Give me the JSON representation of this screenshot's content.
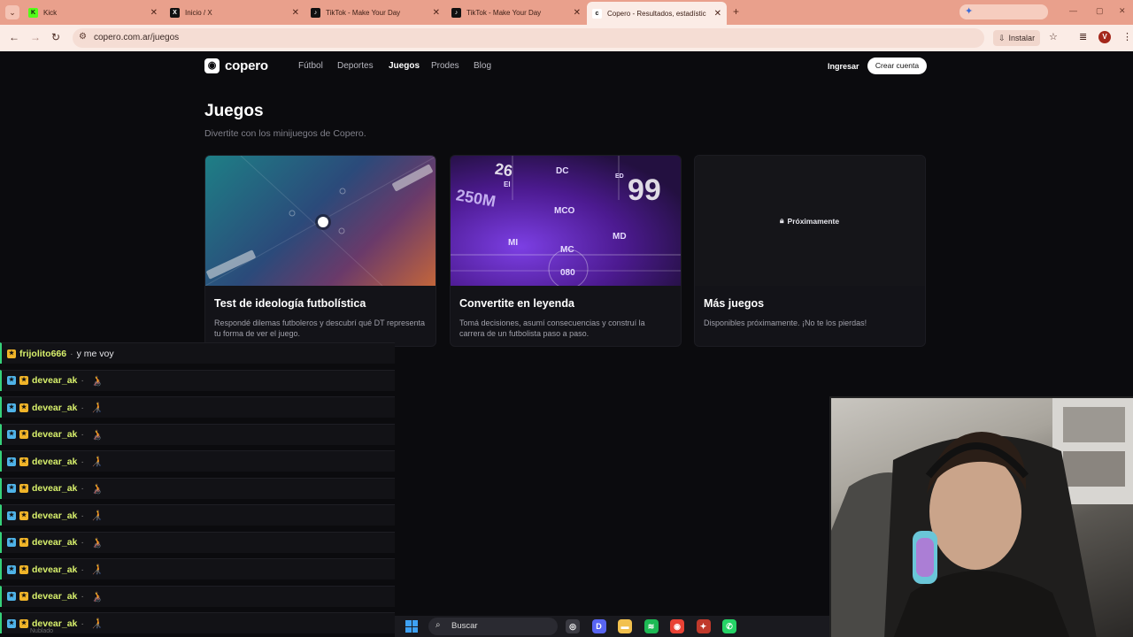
{
  "browser": {
    "tabs": [
      {
        "title": "Kick",
        "favicon": "kick-icon",
        "color": "#53fc18",
        "glyph": "K"
      },
      {
        "title": "Inicio / X",
        "favicon": "x-icon",
        "color": "#111111",
        "glyph": "X"
      },
      {
        "title": "TikTok - Make Your Day",
        "favicon": "tiktok-icon",
        "color": "#111111",
        "glyph": "♪"
      },
      {
        "title": "TikTok - Make Your Day",
        "favicon": "tiktok-icon",
        "color": "#111111",
        "glyph": "♪"
      },
      {
        "title": "Copero - Resultados, estadístic",
        "favicon": "copero-icon",
        "color": "#ffffff",
        "glyph": "c"
      }
    ],
    "url": "copero.com.ar/juegos",
    "install_label": "Instalar",
    "profile_initial": "V"
  },
  "site": {
    "brand": "copero",
    "nav": [
      "Fútbol",
      "Deportes",
      "Juegos",
      "Prodes",
      "Blog"
    ],
    "active_nav": "Juegos",
    "login": "Ingresar",
    "signup": "Crear cuenta",
    "title": "Juegos",
    "subtitle": "Divertite con los minijuegos de Copero.",
    "cards": [
      {
        "title": "Test de ideología futbolística",
        "desc": "Respondé dilemas futboleros y descubrí qué DT representa tu forma de ver el juego."
      },
      {
        "title": "Convertite en leyenda",
        "desc": "Tomá decisiones, asumí consecuencias y construí la carrera de un futbolista paso a paso.",
        "art": {
          "positions": [
            "DC",
            "EI",
            "MCO",
            "MI",
            "MD",
            "MC",
            "ED"
          ],
          "numbers": [
            "26",
            "99",
            "080"
          ],
          "value": "250M"
        }
      },
      {
        "title": "Más juegos",
        "desc": "Disponibles próximamente. ¡No te los pierdas!",
        "badge": "Próximamente"
      }
    ]
  },
  "chat": {
    "messages": [
      {
        "user": "frijolito666",
        "text": "y me voy",
        "emote": ""
      },
      {
        "user": "devear_ak",
        "text": "",
        "emote": "🧑‍🦽"
      },
      {
        "user": "devear_ak",
        "text": "",
        "emote": "🧑‍🦯"
      },
      {
        "user": "devear_ak",
        "text": "",
        "emote": "🧑‍🦽"
      },
      {
        "user": "devear_ak",
        "text": "",
        "emote": "🧑‍🦯"
      },
      {
        "user": "devear_ak",
        "text": "",
        "emote": "🧑‍🦽"
      },
      {
        "user": "devear_ak",
        "text": "",
        "emote": "🧑‍🦯"
      },
      {
        "user": "devear_ak",
        "text": "",
        "emote": "🧑‍🦽"
      },
      {
        "user": "devear_ak",
        "text": "",
        "emote": "🧑‍🦯"
      },
      {
        "user": "devear_ak",
        "text": "",
        "emote": "🧑‍🦽"
      },
      {
        "user": "devear_ak",
        "text": "",
        "emote": "🧑‍🦯"
      }
    ],
    "footer_text": "Nublado"
  },
  "taskbar": {
    "search_label": "Buscar",
    "apps": [
      {
        "name": "obs-icon",
        "color": "#3a3a42",
        "glyph": "◎"
      },
      {
        "name": "discord-icon",
        "color": "#5865f2",
        "glyph": "D"
      },
      {
        "name": "folder-icon",
        "color": "#f2c14e",
        "glyph": "▬"
      },
      {
        "name": "spotify-icon",
        "color": "#1db954",
        "glyph": "≋"
      },
      {
        "name": "chrome-icon",
        "color": "#e94235",
        "glyph": "◉"
      },
      {
        "name": "app-icon",
        "color": "#c0392b",
        "glyph": "✦"
      },
      {
        "name": "whatsapp-icon",
        "color": "#25d366",
        "glyph": "✆"
      }
    ]
  }
}
